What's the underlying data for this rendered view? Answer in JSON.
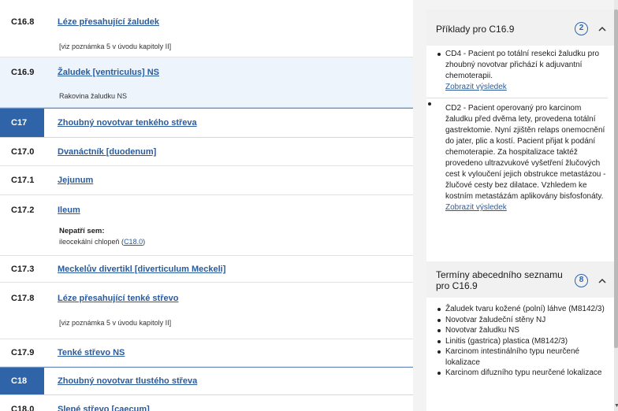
{
  "codes": [
    {
      "code": "C16.8",
      "title": "Léze přesahující žaludek",
      "note": "[viz poznámka 5 v úvodu kapitoly II]"
    },
    {
      "code": "C16.9",
      "title": "Žaludek [ventriculus] NS",
      "note": "Rakovina žaludku NS"
    },
    {
      "code": "C17",
      "title": "Zhoubný novotvar tenkého střeva"
    },
    {
      "code": "C17.0",
      "title": "Dvanáctník [duodenum]"
    },
    {
      "code": "C17.1",
      "title": "Jejunum"
    },
    {
      "code": "C17.2",
      "title": "Ileum",
      "includes_label": "Nepatří sem:",
      "includes_text": "ileocekální chlopeň (",
      "includes_link": "C18.0",
      "includes_end": ")"
    },
    {
      "code": "C17.3",
      "title": "Meckelův divertikl [diverticulum Meckeli]"
    },
    {
      "code": "C17.8",
      "title": "Léze přesahující tenké střevo",
      "note": "[viz poznámka 5 v úvodu kapitoly II]"
    },
    {
      "code": "C17.9",
      "title": "Tenké střevo NS"
    },
    {
      "code": "C18",
      "title": "Zhoubný novotvar tlustého střeva"
    },
    {
      "code": "C18.0",
      "title": "Slepé střevo [caecum]"
    }
  ],
  "panel": {
    "examples": {
      "title": "Příklady pro C16.9",
      "count": "2",
      "items": [
        {
          "text": "CD4 - Pacient po totální resekci žaludku pro zhoubný novotvar přichází k adjuvantní chemoterapii.",
          "link": "Zobrazit výsledek"
        },
        {
          "text": "CD2 - Pacient operovaný pro karcinom žaludku před dvěma lety, provedena totální gastrektomie. Nyní zjištěn relaps onemocnění do jater, plic a kostí. Pacient přijat k podání chemoterapie. Za hospitalizace taktéž provedeno ultrazvukové vyšetření žlučových cest k vyloučení jejich obstrukce metastázou - žlučové cesty bez dilatace. Vzhledem ke kostním metastázám aplikovány bisfosfonáty.",
          "link": "Zobrazit výsledek"
        }
      ]
    },
    "terms": {
      "title": "Termíny abecedního seznamu pro C16.9",
      "count": "8",
      "items": [
        "Žaludek tvaru kožené (polní) láhve (M8142/3)",
        "Novotvar žaludeční stěny NJ",
        "Novotvar žaludku NS",
        "Linitis (gastrica) plastica (M8142/3)",
        "Karcinom intestinálního typu neurčené lokalizace",
        "Karcinom difuzního typu neurčené lokalizace"
      ]
    }
  },
  "icons": {
    "collapse": "chevron-up-icon",
    "scroll": "scroll-down-icon"
  },
  "colors": {
    "accent": "#2f64a8",
    "link": "#2a5b9c",
    "selected_row": "#eef4fb"
  }
}
